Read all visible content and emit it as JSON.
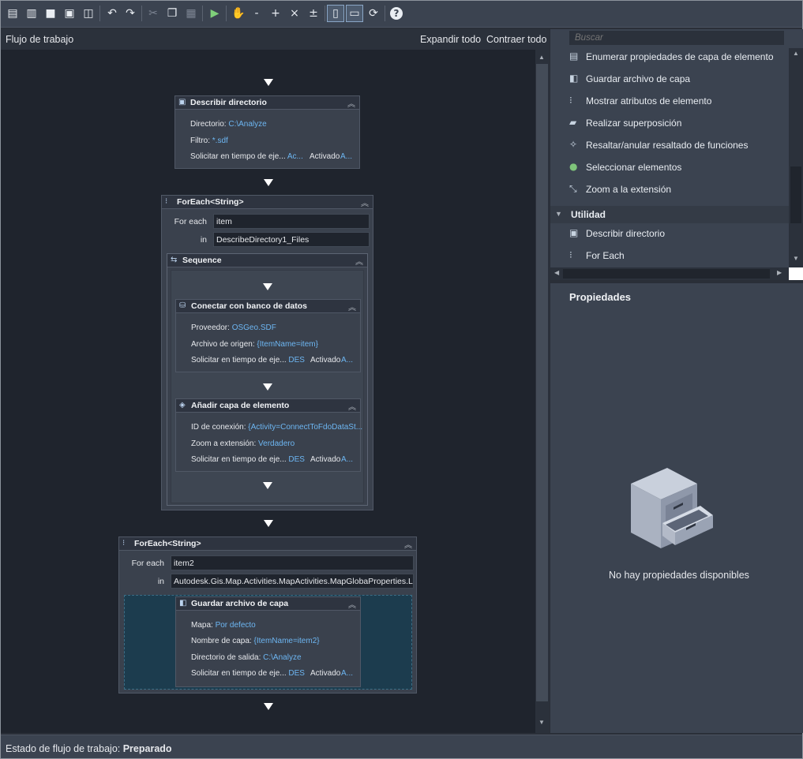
{
  "toolbar": {
    "buttons": [
      {
        "name": "new-workflow",
        "glyph": "▤"
      },
      {
        "name": "open",
        "glyph": "▥"
      },
      {
        "name": "save",
        "glyph": "■"
      },
      {
        "name": "save-as",
        "glyph": "▣"
      },
      {
        "name": "save-copy",
        "glyph": "◫"
      },
      {
        "name": "undo",
        "glyph": "↶"
      },
      {
        "name": "redo",
        "glyph": "↷"
      },
      {
        "name": "cut",
        "glyph": "✂"
      },
      {
        "name": "copy",
        "glyph": "❐"
      },
      {
        "name": "paste",
        "glyph": "▦"
      },
      {
        "name": "run",
        "glyph": "▶"
      },
      {
        "name": "pan",
        "glyph": "✋"
      },
      {
        "name": "zoom-out",
        "glyph": "-"
      },
      {
        "name": "zoom-in",
        "glyph": "+"
      },
      {
        "name": "zoom-fit",
        "glyph": "×"
      },
      {
        "name": "zoom-actual",
        "glyph": "±"
      },
      {
        "name": "layout-vertical",
        "glyph": "▯"
      },
      {
        "name": "layout-horizontal",
        "glyph": "▭"
      },
      {
        "name": "refresh",
        "glyph": "⟳"
      },
      {
        "name": "help",
        "glyph": "?"
      }
    ]
  },
  "workflow": {
    "title": "Flujo de trabajo",
    "expand_all": "Expandir todo",
    "collapse_all": "Contraer todo",
    "describe_dir": {
      "title": "Describir directorio",
      "dir_label": "Directorio: ",
      "dir_value": "C:\\Analyze",
      "filter_label": "Filtro: ",
      "filter_value": "*.sdf",
      "prompt_label": "Solicitar en tiempo de eje...",
      "prompt_value": "Ac...",
      "active_label": "Activado",
      "active_value": "A..."
    },
    "foreach1": {
      "title": "ForEach<String>",
      "foreach_label": "For each",
      "foreach_value": "item",
      "in_label": "in",
      "in_value": "DescribeDirectory1_Files",
      "sequence_title": "Sequence",
      "connect": {
        "title": "Conectar con banco de datos",
        "provider_label": "Proveedor: ",
        "provider_value": "OSGeo.SDF",
        "source_label": "Archivo de origen: ",
        "source_value": "{ItemName=item}",
        "prompt_label": "Solicitar en tiempo de eje...",
        "prompt_value": "DES",
        "active_label": "Activado",
        "active_value": "A..."
      },
      "addlayer": {
        "title": "Añadir capa de elemento",
        "conn_label": "ID de conexión: ",
        "conn_value": "{Activity=ConnectToFdoDataSt...",
        "zoom_label": "Zoom a extensión: ",
        "zoom_value": "Verdadero",
        "prompt_label": "Solicitar en tiempo de eje...",
        "prompt_value": "DES",
        "active_label": "Activado",
        "active_value": "A..."
      }
    },
    "foreach2": {
      "title": "ForEach<String>",
      "foreach_label": "For each",
      "foreach_value": "item2",
      "in_label": "in",
      "in_value": "Autodesk.Gis.Map.Activities.MapActivities.MapGlobaProperties.Layers",
      "savelayer": {
        "title": "Guardar archivo de capa",
        "map_label": "Mapa: ",
        "map_value": "Por defecto",
        "layer_label": "Nombre de capa: ",
        "layer_value": "{ItemName=item2}",
        "outdir_label": "Directorio de salida: ",
        "outdir_value": "C:\\Analyze",
        "prompt_label": "Solicitar en tiempo de eje...",
        "prompt_value": "DES",
        "active_label": "Activado",
        "active_value": "A..."
      }
    }
  },
  "toolbox": {
    "search_placeholder": "Buscar",
    "items": [
      {
        "label": "Enumerar propiedades de capa de elemento",
        "icon": "list-layer-icon"
      },
      {
        "label": "Guardar archivo de capa",
        "icon": "save-layer-icon"
      },
      {
        "label": "Mostrar atributos de elemento",
        "icon": "attributes-icon"
      },
      {
        "label": "Realizar superposición",
        "icon": "overlay-icon"
      },
      {
        "label": "Resaltar/anular resaltado de funciones",
        "icon": "highlight-icon"
      },
      {
        "label": "Seleccionar elementos",
        "icon": "select-icon"
      },
      {
        "label": "Zoom a la extensión",
        "icon": "zoom-extent-icon"
      }
    ],
    "group_label": "Utilidad",
    "group_items": [
      {
        "label": "Describir directorio",
        "icon": "folder-icon"
      },
      {
        "label": "For Each",
        "icon": "foreach-icon"
      }
    ]
  },
  "properties": {
    "title": "Propiedades",
    "empty_text": "No hay propiedades disponibles"
  },
  "status": {
    "label": "Estado de flujo de trabajo: ",
    "value": "Preparado"
  }
}
